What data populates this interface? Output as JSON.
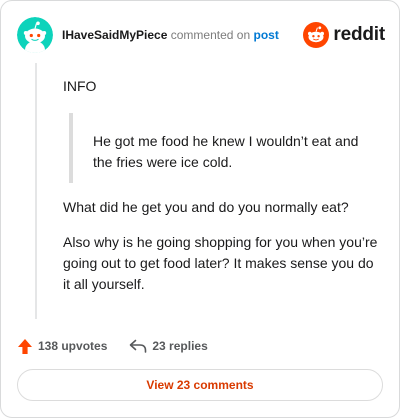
{
  "comment": {
    "username": "IHaveSaidMyPiece",
    "action_text": "commented on",
    "post_link_text": "post",
    "brand_name": "reddit",
    "intro": "INFO",
    "quote": "He got me food he knew I wouldn’t eat and the fries were ice cold.",
    "paragraphs": [
      "What did he get you and do you normally eat?",
      "Also why is he going shopping for you when you’re going out to get food later? It makes sense you do it all yourself."
    ]
  },
  "footer": {
    "upvotes": "138 upvotes",
    "replies": "23 replies",
    "view_comments": "View 23 comments"
  },
  "icons": {
    "avatar": "reddit-snoo-avatar-icon",
    "brand": "reddit-logo-icon",
    "upvote": "upvote-arrow-icon",
    "reply": "reply-arrow-icon"
  },
  "colors": {
    "avatar_bg": "#0dd3bb",
    "brand_orange": "#ff4500",
    "link_blue": "#0079d3",
    "upvote_orange": "#ff4500",
    "view_button_text": "#d93a00"
  }
}
